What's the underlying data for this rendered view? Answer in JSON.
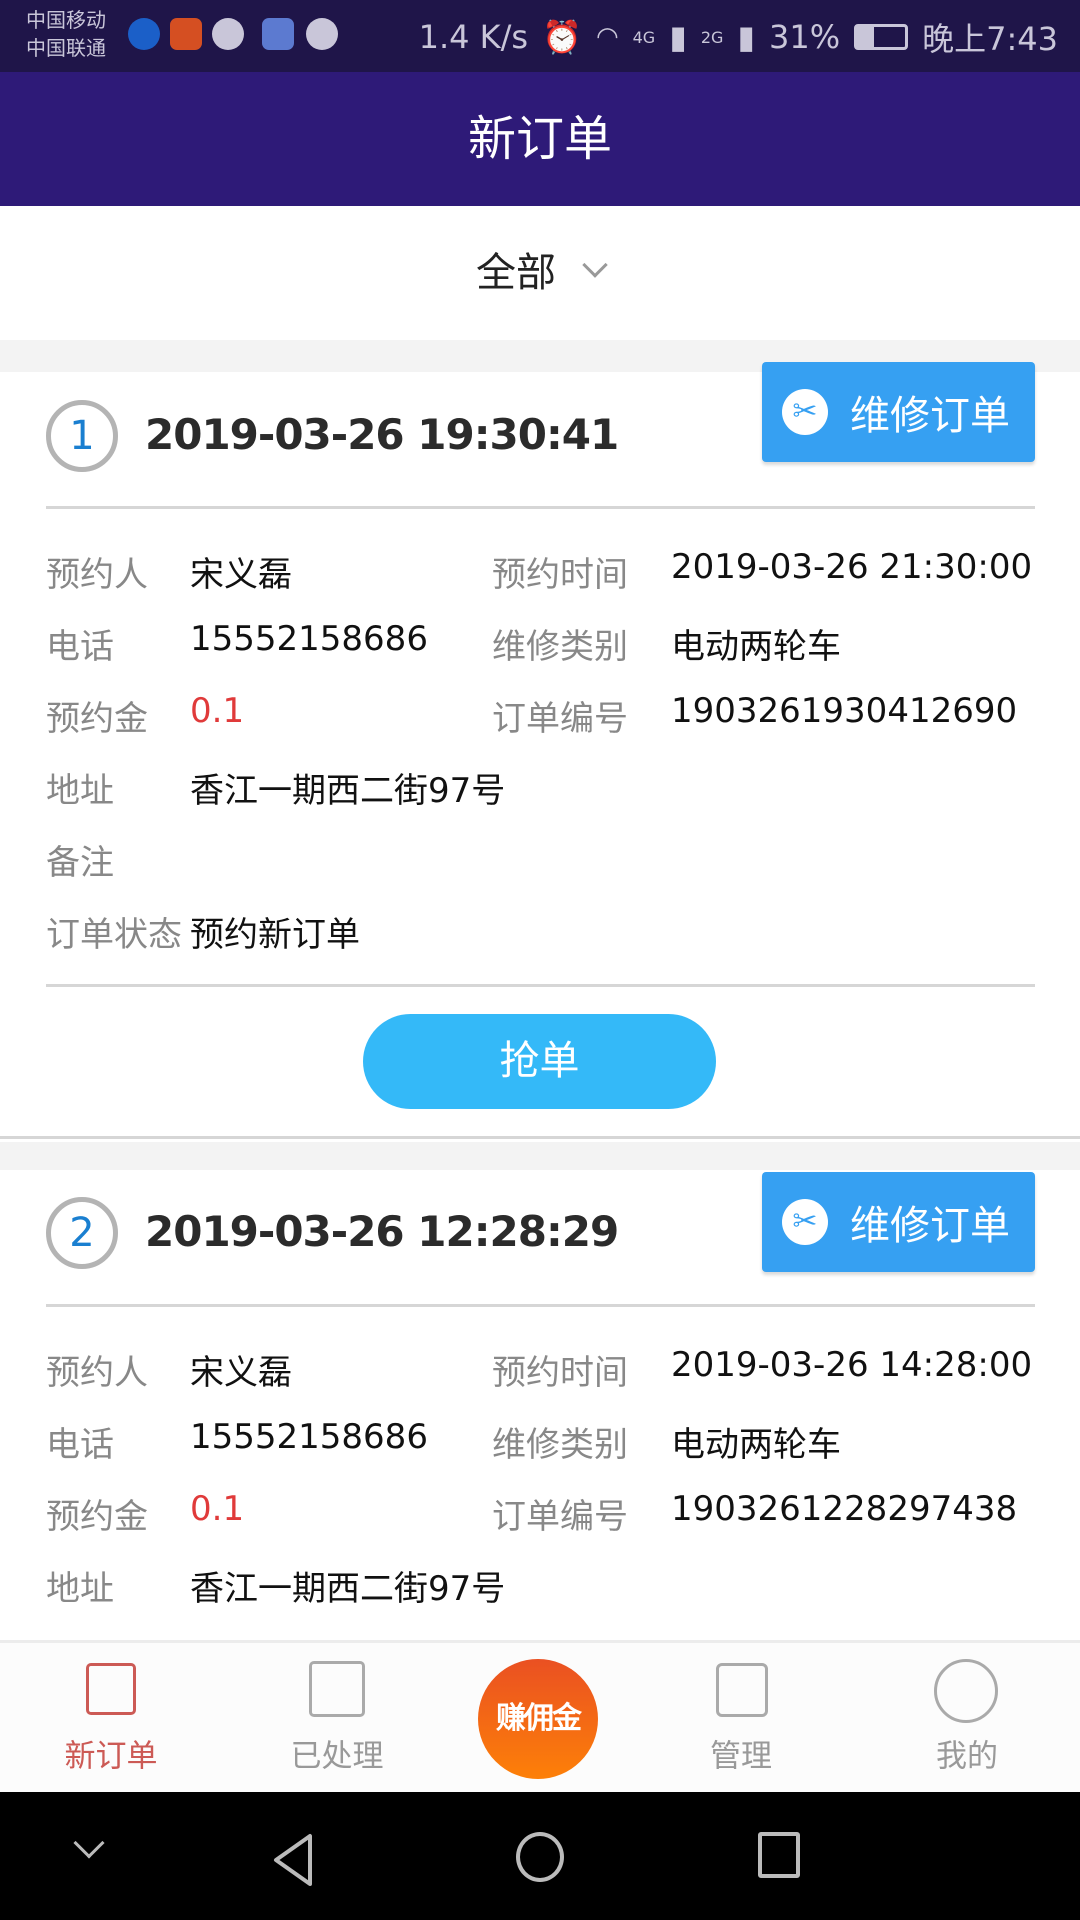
{
  "status_bar": {
    "carrier1": "中国移动",
    "carrier2": "中国联通",
    "speed": "1.4 K/s",
    "net1": "4G",
    "net2": "2G",
    "battery": "31%",
    "time": "晚上7:43"
  },
  "header": {
    "title": "新订单"
  },
  "filter": {
    "selected": "全部"
  },
  "labels": {
    "booker": "预约人",
    "phone": "电话",
    "deposit": "预约金",
    "address": "地址",
    "remark": "备注",
    "status": "订单状态",
    "book_time": "预约时间",
    "repair_type": "维修类别",
    "order_no": "订单编号"
  },
  "orders": [
    {
      "index": "1",
      "created": "2019-03-26 19:30:41",
      "badge": "维修订单",
      "booker": "宋义磊",
      "phone": "15552158686",
      "deposit": "0.1",
      "address": "香江一期西二街97号",
      "remark": "",
      "status": "预约新订单",
      "book_time": "2019-03-26 21:30:00",
      "repair_type": "电动两轮车",
      "order_no": "1903261930412690",
      "action": "抢单"
    },
    {
      "index": "2",
      "created": "2019-03-26 12:28:29",
      "badge": "维修订单",
      "booker": "宋义磊",
      "phone": "15552158686",
      "deposit": "0.1",
      "address": "香江一期西二街97号",
      "book_time": "2019-03-26 14:28:00",
      "repair_type": "电动两轮车",
      "order_no": "1903261228297438"
    }
  ],
  "tabbar": {
    "items": [
      {
        "label": "新订单",
        "active": true
      },
      {
        "label": "已处理"
      },
      {
        "label": "赚佣金"
      },
      {
        "label": "管理"
      },
      {
        "label": "我的"
      }
    ]
  },
  "colors": {
    "header": "#2e1a78",
    "accent": "#34b9f8",
    "badge": "#36a0f2",
    "active_tab": "#cc5a55",
    "deposit": "#e03a3a"
  }
}
